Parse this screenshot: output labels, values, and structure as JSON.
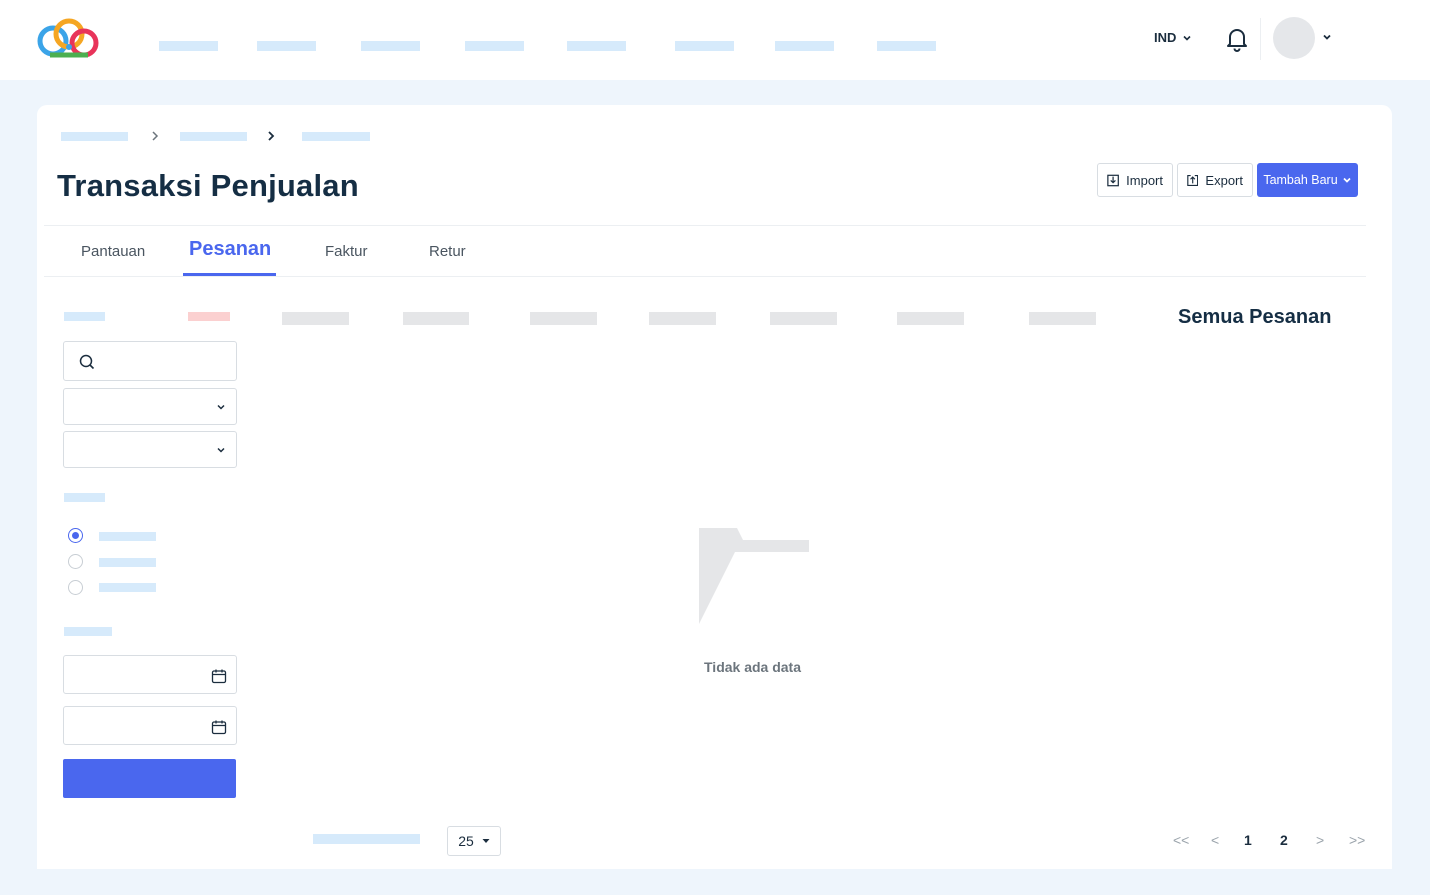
{
  "header": {
    "language": "IND",
    "nav_placeholders": 8
  },
  "page": {
    "title": "Transaksi Penjualan",
    "buttons": {
      "import": "Import",
      "export": "Export",
      "add_new": "Tambah Baru"
    },
    "tabs": [
      {
        "label": "Pantauan",
        "active": false
      },
      {
        "label": "Pesanan",
        "active": true
      },
      {
        "label": "Faktur",
        "active": false
      },
      {
        "label": "Retur",
        "active": false
      }
    ]
  },
  "filters": {
    "status_radio_selected_index": 0,
    "status_radio_count": 3
  },
  "content": {
    "section_title": "Semua Pesanan",
    "empty_text": "Tidak ada data"
  },
  "pagination": {
    "per_page": "25",
    "first": "<<",
    "prev": "<",
    "pages": [
      "1",
      "2"
    ],
    "next": ">",
    "last": ">>"
  },
  "colors": {
    "accent": "#4a67ee",
    "title": "#152e44",
    "placeholder_blue": "#d6eafb",
    "placeholder_red": "#fbd0d0",
    "background": "#eef5fc"
  }
}
